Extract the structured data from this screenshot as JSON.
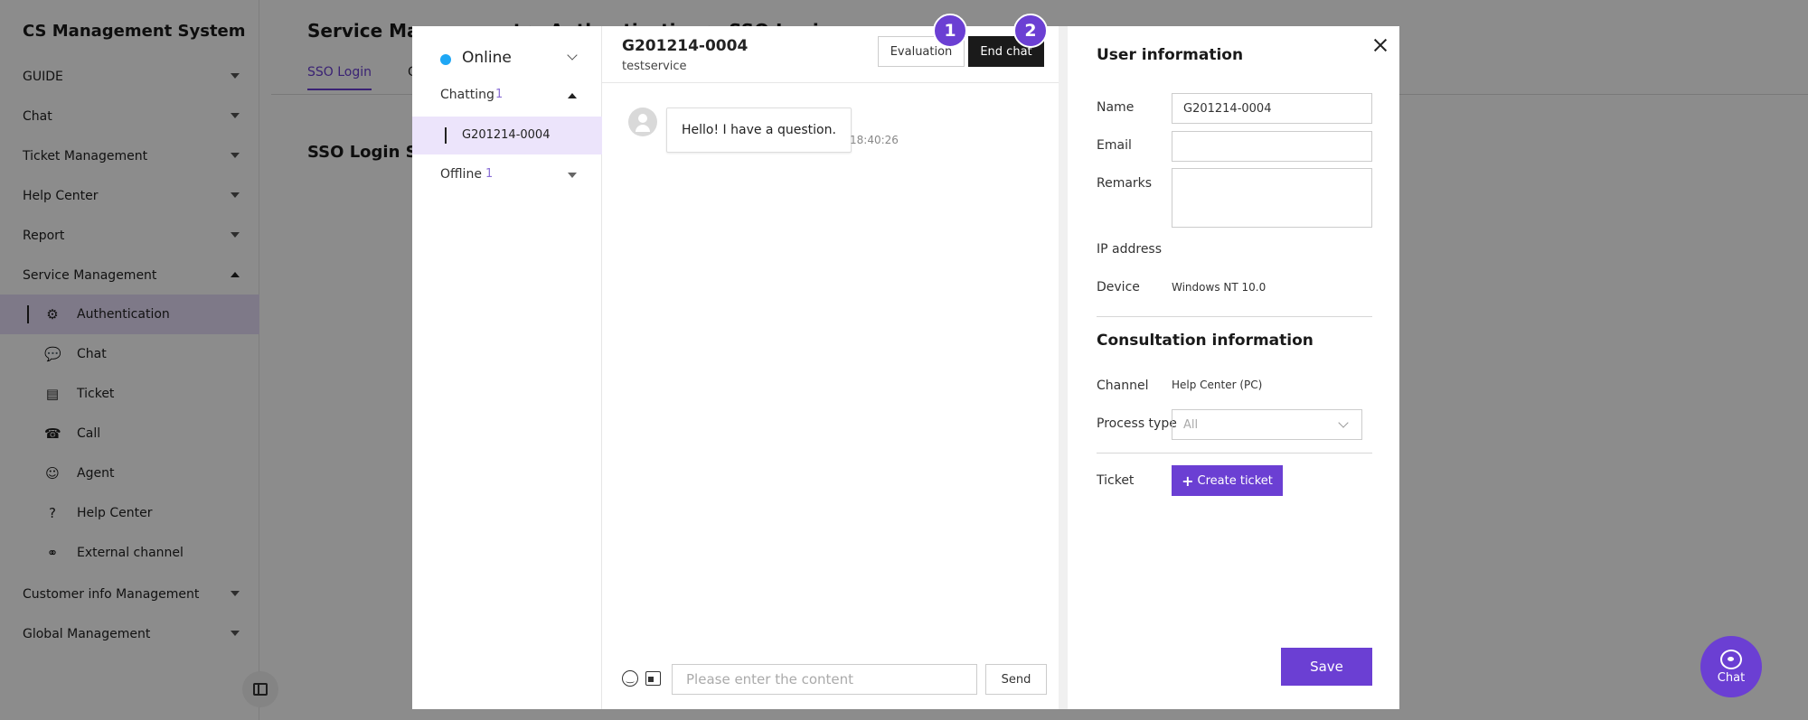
{
  "app": {
    "title": "CS Management System"
  },
  "sidebar": {
    "menus": [
      {
        "label": "GUIDE"
      },
      {
        "label": "Chat"
      },
      {
        "label": "Ticket Management"
      },
      {
        "label": "Help Center"
      },
      {
        "label": "Report"
      },
      {
        "label": "Service Management"
      }
    ],
    "sub_items": [
      {
        "label": "Authentication",
        "icon": "gear-icon"
      },
      {
        "label": "Chat",
        "icon": "chat-icon"
      },
      {
        "label": "Ticket",
        "icon": "ticket-icon"
      },
      {
        "label": "Call",
        "icon": "phone-icon"
      },
      {
        "label": "Agent",
        "icon": "agent-icon"
      },
      {
        "label": "Help Center",
        "icon": "help-icon"
      },
      {
        "label": "External channel",
        "icon": "external-channel-icon"
      }
    ],
    "bottom_menus": [
      {
        "label": "Customer info Management"
      },
      {
        "label": "Global Management"
      }
    ]
  },
  "main": {
    "title": "Service Management > Authentication > SSO Login",
    "tabs": [
      {
        "label": "SSO Login"
      },
      {
        "label": "O"
      }
    ],
    "section_title": "SSO Login Settings"
  },
  "modal": {
    "status": {
      "label": "Online",
      "color": "#1ea7f5"
    },
    "groups": {
      "chatting": {
        "label": "Chatting",
        "count": "1"
      },
      "offline": {
        "label": "Offline",
        "count": "1"
      }
    },
    "chat_list": [
      {
        "id": "G201214-0004"
      }
    ],
    "chat": {
      "id": "G201214-0004",
      "service": "testservice",
      "evaluation_label": "Evaluation",
      "end_chat_label": "End chat",
      "badges": [
        "1",
        "2"
      ],
      "messages": [
        {
          "text": "Hello! I have a question.",
          "time": "18:40:26"
        }
      ],
      "composer_placeholder": "Please enter the content",
      "send_label": "Send"
    },
    "user_info": {
      "title": "User information",
      "name_label": "Name",
      "name_value": "G201214-0004",
      "email_label": "Email",
      "email_value": "",
      "remarks_label": "Remarks",
      "ip_label": "IP address",
      "ip_value": "",
      "device_label": "Device",
      "device_value": "Windows NT 10.0",
      "consultation_title": "Consultation information",
      "channel_label": "Channel",
      "channel_value": "Help Center (PC)",
      "process_type_label": "Process type",
      "process_type_value": "All",
      "ticket_label": "Ticket",
      "create_ticket_label": "Create ticket",
      "save_label": "Save"
    }
  },
  "fab": {
    "label": "Chat"
  },
  "colors": {
    "accent": "#6b3fd3",
    "online": "#1ea7f5",
    "dark_button": "#1a1a1a"
  }
}
